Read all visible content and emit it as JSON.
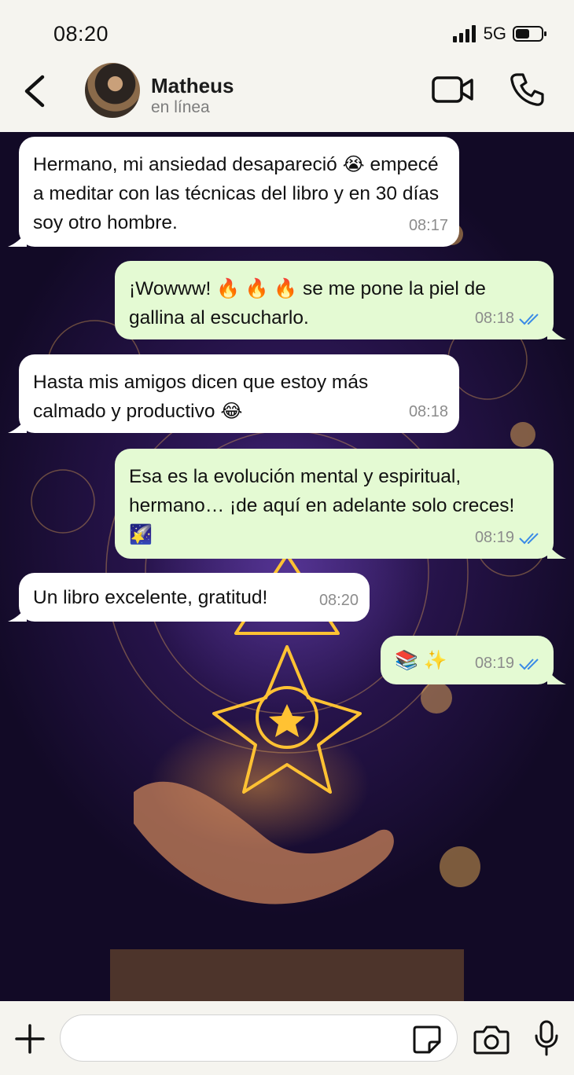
{
  "status_bar": {
    "time": "08:20",
    "network": "5G"
  },
  "header": {
    "back_icon": "chevron-left-icon",
    "contact_name": "Matheus",
    "contact_status": "en línea"
  },
  "messages": [
    {
      "direction": "in",
      "text_before": "Hermano, mi ansiedad desapareció ",
      "emoji": "😭",
      "text_after": " empecé a meditar con las técnicas del libro y en 30 días soy otro hombre.",
      "time": "08:17"
    },
    {
      "direction": "out",
      "text_before": "¡Wowww! ",
      "emoji": "🔥 🔥 🔥",
      "text_after": " se me pone la piel de gallina al escucharlo.",
      "time": "08:18",
      "read": true
    },
    {
      "direction": "in",
      "text_before": "Hasta mis amigos dicen que estoy más calmado y productivo ",
      "emoji": "😂",
      "text_after": "",
      "time": "08:18"
    },
    {
      "direction": "out",
      "text_before": "Esa es la evolución mental y espiritual, hermano… ¡de aquí en adelante solo creces! ",
      "emoji": "🌠",
      "text_after": "",
      "time": "08:19",
      "read": true
    },
    {
      "direction": "in",
      "text_before": "Un libro excelente, gratitud!",
      "emoji": "",
      "text_after": "",
      "time": "08:20"
    },
    {
      "direction": "out",
      "text_before": "",
      "emoji": "📚 ✨",
      "text_after": "",
      "time": "08:19",
      "read": true
    }
  ],
  "input": {
    "placeholder": ""
  },
  "colors": {
    "incoming": "#ffffff",
    "outgoing": "#e4fad3",
    "read_tick": "#3b8be6",
    "wallpaper": "#241246"
  }
}
